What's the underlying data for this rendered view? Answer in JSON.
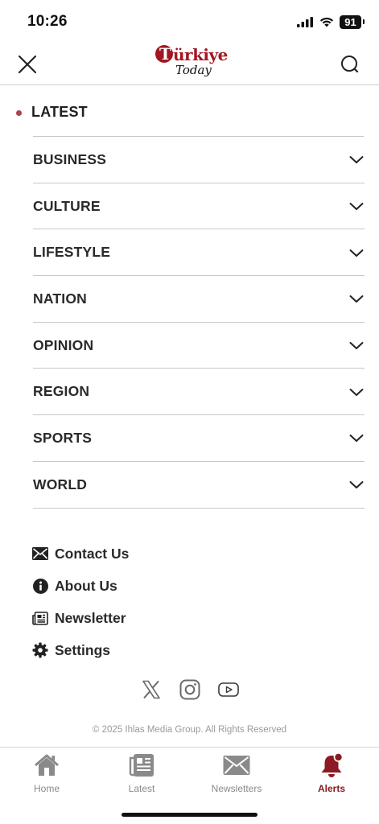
{
  "status_bar": {
    "time": "10:26",
    "battery": "91"
  },
  "header": {
    "logo_top": "ürkiye",
    "logo_initial": "T",
    "logo_bottom": "Today"
  },
  "menu": {
    "latest": "LATEST",
    "items": [
      {
        "label": "BUSINESS"
      },
      {
        "label": "CULTURE"
      },
      {
        "label": "LIFESTYLE"
      },
      {
        "label": "NATION"
      },
      {
        "label": "OPINION"
      },
      {
        "label": "REGION"
      },
      {
        "label": "SPORTS"
      },
      {
        "label": "WORLD"
      }
    ]
  },
  "links": {
    "contact": "Contact Us",
    "about": "About Us",
    "newsletter": "Newsletter",
    "settings": "Settings"
  },
  "footer": {
    "copyright": "© 2025 Ihlas Media Group. All Rights Reserved"
  },
  "tabbar": {
    "home": "Home",
    "latest": "Latest",
    "newsletters": "Newsletters",
    "alerts": "Alerts"
  },
  "colors": {
    "brand": "#a31621",
    "active_tab": "#8b1a22",
    "divider": "#c7c7c7"
  }
}
